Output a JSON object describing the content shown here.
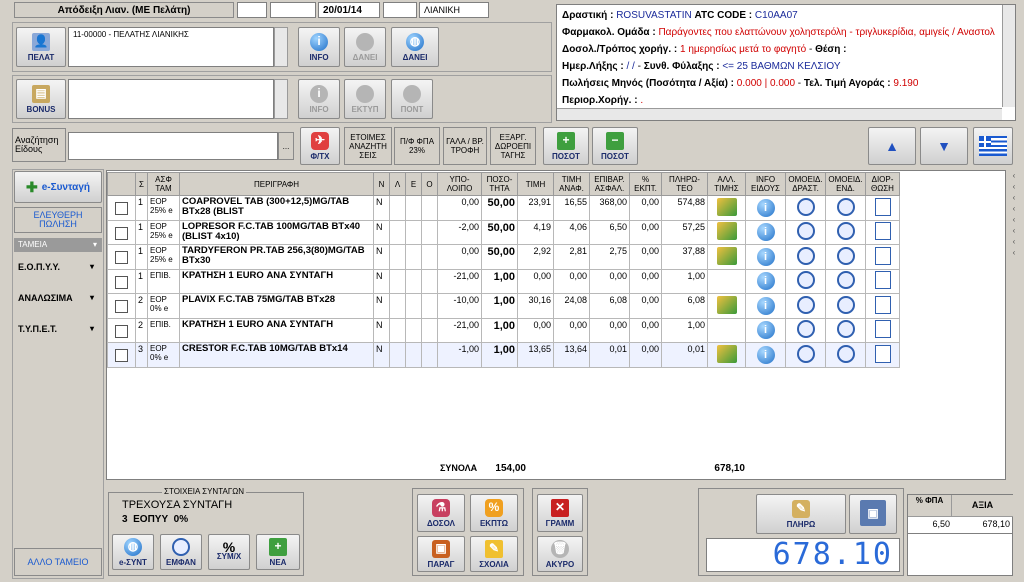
{
  "header": {
    "receipt_title": "Απόδειξη Λιαν. (ΜΕ Πελάτη)",
    "date": "20/01/14",
    "sale_type": "ΛΙΑΝΙΚΗ"
  },
  "customer": {
    "value": "11-00000 - ΠΕΛΑΤΗΣ ΛΙΑΝΙΚΗΣ",
    "pelat_label": "ΠΕΛΑΤ",
    "info_label": "INFO",
    "danei1_label": "ΔΑΝΕΙ",
    "danei2_label": "ΔΑΝΕΙ"
  },
  "bonus": {
    "label": "BONUS",
    "info_label": "INFO",
    "ektyp_label": "ΕΚΤΥΠ",
    "pont_label": "ΠΟΝΤ"
  },
  "search": {
    "label": "Αναζήτηση Είδους",
    "value": "",
    "dots": "...",
    "ftx_label": "Φ/ΤΧ",
    "ready_label": "ΕΤΟΙΜΕΣ ΑΝΑΖΗΤΗ ΣΕΙΣ",
    "fpa_label": "Π/Φ ΦΠΑ 23%",
    "gala_label": "ΓΑΛΑ / ΒΡ. ΤΡΟΦΗ",
    "exarg_label": "ΕΞΑΡΓ. ΔΩΡΟΕΠΙ ΤΑΓΗΣ",
    "plus_label": "ΠΟΣΟΤ",
    "minus_label": "ΠΟΣΟΤ"
  },
  "drug_info": {
    "substance_label": "Δραστική :",
    "substance": "ROSUVASTATIN",
    "atc_label": "ATC CODE :",
    "atc": "C10AA07",
    "group_label": "Φαρμακολ. Ομάδα :",
    "group": "Παράγοντες που ελαττώνουν χοληστερόλη - τριγλυκερίδια, αμιγείς  / Αναστολ",
    "dose_label": "Δοσολ./Τρόπος χορήγ. :",
    "dose": "1 ημερησίως μετά το φαγητό",
    "position_label": "Θέση :",
    "expiry_label": "Ημερ.Λήξης :",
    "expiry": "/  /",
    "storage_label": "Συνθ. Φύλαξης :",
    "storage": "<= 25 ΒΑΘΜΩΝ ΚΕΛΣΙΟΥ",
    "sales_label": "Πωλήσεις Μηνός (Ποσότητα / Αξία) :",
    "sales": "0.000 | 0.000",
    "last_price_label": "Τελ. Τιμή Αγοράς :",
    "last_price": "9.190",
    "restriction_label": "Περιορ.Χορήγ. :",
    "restriction": "."
  },
  "sidebar": {
    "esyntagi": "e-Συνταγή",
    "free_price": "ΕΛΕΥΘΕΡΗ ΠΩΛΗΣΗ",
    "funds_header": "ΤΑΜΕΙΑ",
    "funds": [
      "Ε.Ο.Π.Υ.Υ.",
      "ΑΝΑΛΩΣΙΜΑ",
      "Τ.Υ.Π.Ε.Τ."
    ],
    "other_fund": "ΑΛΛΟ ΤΑΜΕΙΟ"
  },
  "grid": {
    "headers": [
      "",
      "Σ",
      "ΑΣΦ ΤΑΜ",
      "ΠΕΡΙΓΡΑΦΗ",
      "Ν",
      "Λ",
      "Ε",
      "Ο",
      "ΥΠΟ- ΛΟΙΠΟ",
      "ΠΟΣΟ- ΤΗΤΑ",
      "ΤΙΜΗ",
      "ΤΙΜΗ ΑΝΑΦ.",
      "ΕΠΙΒΑΡ. ΑΣΦΑΛ.",
      "% ΕΚΠΤ.",
      "ΠΛΗΡΩ- ΤΕΟ",
      "ΑΛΛ. ΤΙΜΗΣ",
      "INFO ΕΙΔΟΥΣ",
      "ΟΜΟΕΙΔ. ΔΡΑΣΤ.",
      "ΟΜΟΕΙΔ. ΕΝΔ.",
      "ΔΙΟΡ- ΘΩΣΗ"
    ],
    "rows": [
      {
        "s": "1",
        "fund": "EOP 25% e",
        "desc": "COAPROVEL TAB (300+12,5)MG/TAB BTx28 (BLIST",
        "n": "N",
        "rest": "0,00",
        "qty": "50,00",
        "price": "23,91",
        "ref": "16,55",
        "extra": "368,00",
        "disc": "0,00",
        "pay": "574,88",
        "alt": true
      },
      {
        "s": "1",
        "fund": "EOP 25% e",
        "desc": "LOPRESOR F.C.TAB 100MG/TAB BTx40 (BLIST 4x10)",
        "n": "N",
        "rest": "-2,00",
        "qty": "50,00",
        "price": "4,19",
        "ref": "4,06",
        "extra": "6,50",
        "disc": "0,00",
        "pay": "57,25",
        "alt": true
      },
      {
        "s": "1",
        "fund": "EOP 25% e",
        "desc": "TARDYFERON PR.TAB 256,3(80)MG/TAB BTx30",
        "n": "N",
        "rest": "0,00",
        "qty": "50,00",
        "price": "2,92",
        "ref": "2,81",
        "extra": "2,75",
        "disc": "0,00",
        "pay": "37,88",
        "alt": true
      },
      {
        "s": "1",
        "fund": "ΕΠΙΒ.",
        "desc": "ΚΡΑΤΗΣΗ 1 EURO ΑΝΑ ΣΥΝΤΑΓΗ",
        "n": "N",
        "rest": "-21,00",
        "qty": "1,00",
        "price": "0,00",
        "ref": "0,00",
        "extra": "0,00",
        "disc": "0,00",
        "pay": "1,00",
        "alt": false
      },
      {
        "s": "2",
        "fund": "EOP 0% e",
        "desc": "PLAVIX F.C.TAB 75MG/TAB BTx28",
        "n": "N",
        "rest": "-10,00",
        "qty": "1,00",
        "price": "30,16",
        "ref": "24,08",
        "extra": "6,08",
        "disc": "0,00",
        "pay": "6,08",
        "alt": true
      },
      {
        "s": "2",
        "fund": "ΕΠΙΒ.",
        "desc": "ΚΡΑΤΗΣΗ 1 EURO ΑΝΑ ΣΥΝΤΑΓΗ",
        "n": "N",
        "rest": "-21,00",
        "qty": "1,00",
        "price": "0,00",
        "ref": "0,00",
        "extra": "0,00",
        "disc": "0,00",
        "pay": "1,00",
        "alt": false
      },
      {
        "s": "3",
        "fund": "EOP 0% e",
        "desc": "CRESTOR F.C.TAB 10MG/TAB BTx14",
        "n": "N",
        "rest": "-1,00",
        "qty": "1,00",
        "price": "13,65",
        "ref": "13,64",
        "extra": "0,01",
        "disc": "0,00",
        "pay": "0,01",
        "alt": true
      }
    ],
    "totals_label": "ΣΥΝΟΛΑ",
    "total_qty": "154,00",
    "total_pay": "678,10"
  },
  "prescription": {
    "title": "ΣΤΟΙΧΕΙΑ ΣΥΝΤΑΓΩΝ",
    "current": "ΤΡΕΧΟΥΣΑ ΣΥΝΤΑΓΗ",
    "summary": "3  ΕΟΠΥΥ  0%",
    "esynt": "e-ΣΥΝΤ",
    "emfan": "ΕΜΦΑΝ",
    "symx": "ΣΥΜ/Χ",
    "nea": "ΝΕΑ"
  },
  "actions": {
    "dosol": "ΔΟΣΟΛ",
    "ekpt": "ΕΚΠΤΩ",
    "parag": "ΠΑΡΑΓ",
    "sxolia": "ΣΧΟΛΙΑ",
    "gramm": "ΓΡΑΜΜ",
    "akyro": "ΑΚΥΡΟ"
  },
  "payment": {
    "pay_label": "ΠΛΗΡΩ",
    "display": "678.10",
    "fpa_header": "% ΦΠΑ",
    "axia_header": "ΑΞΙΑ",
    "fpa": "6,50",
    "axia": "678,10"
  },
  "colors": {
    "accent": "#1a2a9a",
    "red": "#d00000",
    "display": "#2a6ad8"
  }
}
